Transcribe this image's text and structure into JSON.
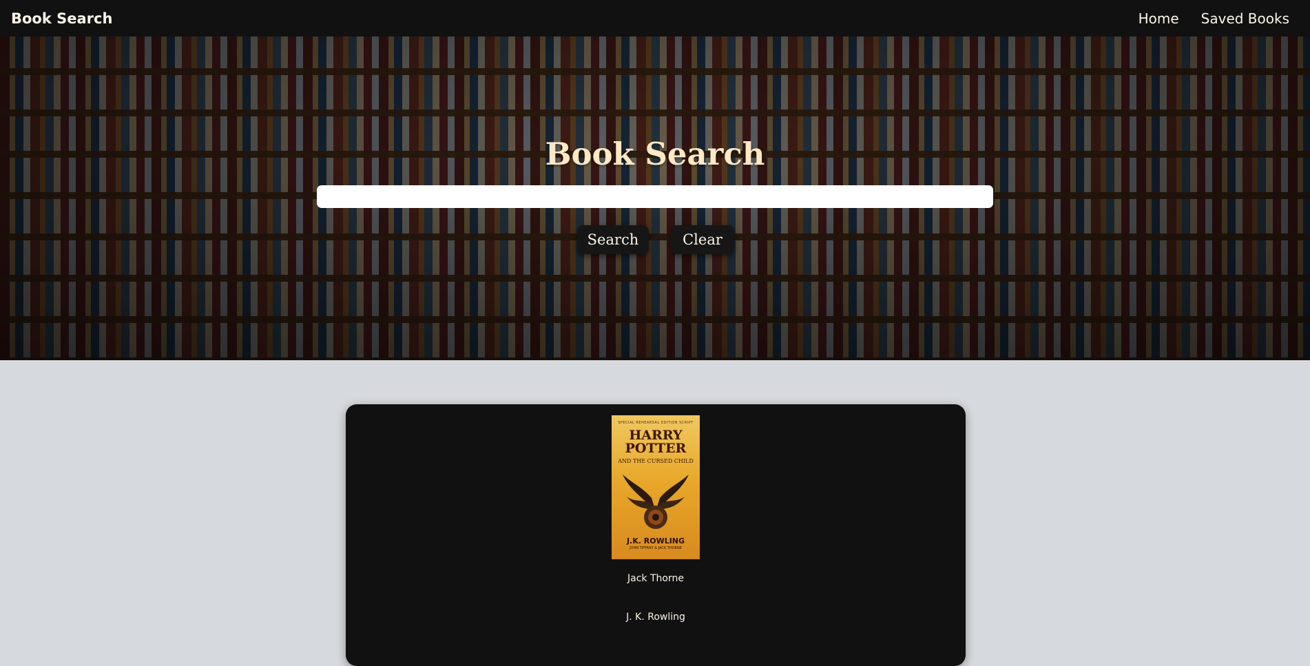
{
  "navbar": {
    "brand": "Book Search",
    "links": [
      "Home",
      "Saved Books"
    ]
  },
  "hero": {
    "title": "Book Search",
    "search_value": "",
    "buttons": {
      "search": "Search",
      "clear": "Clear"
    }
  },
  "results": [
    {
      "cover": {
        "top_text": "SPECIAL REHEARSAL EDITION SCRIPT",
        "title_line_1": "HARRY",
        "title_line_2": "POTTER",
        "subtitle": "AND THE CURSED CHILD",
        "author": "J.K. ROWLING",
        "credits": "JOHN TIFFANY & JACK THORNE"
      },
      "authors": [
        "Jack Thorne",
        "J. K. Rowling"
      ]
    }
  ],
  "colors": {
    "navbar_bg": "#111111",
    "accent_text": "#fdf5e6",
    "hero_title": "#fde9c4",
    "page_bg": "#d6d9dd",
    "card_bg": "#111111"
  }
}
